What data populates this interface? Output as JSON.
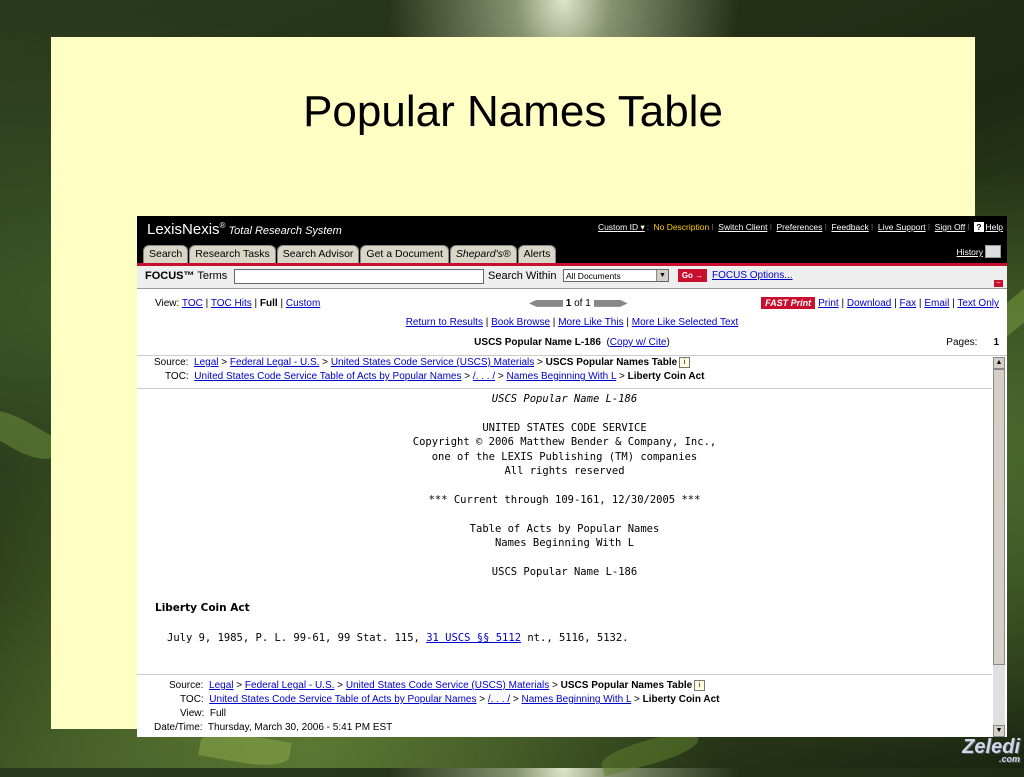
{
  "slide": {
    "title": "Popular Names Table"
  },
  "header": {
    "logo_main": "LexisNexis",
    "logo_reg": "®",
    "logo_sub": "Total Research System",
    "custom_id": "Custom ID ▾",
    "no_description": "No Description",
    "links": [
      "Switch Client",
      "Preferences",
      "Feedback",
      "Live Support",
      "Sign Off"
    ],
    "help_icon": "?",
    "help": "Help",
    "history": "History"
  },
  "tabs": [
    "Search",
    "Research Tasks",
    "Search Advisor",
    "Get a Document",
    "Shepard's®",
    "Alerts"
  ],
  "focus": {
    "label_bold": "FOCUS™",
    "label_terms": "Terms",
    "search_within": "Search Within",
    "scope": "All Documents",
    "go": "Go →",
    "options": "FOCUS Options...",
    "collapse": "–"
  },
  "view": {
    "label": "View:",
    "options": [
      "TOC",
      "TOC Hits",
      "Full",
      "Custom"
    ],
    "selected": "Full"
  },
  "pager": {
    "current": "1",
    "of_total": "of 1"
  },
  "delivery": {
    "fast_print": "FAST Print",
    "links": [
      "Print",
      "Download",
      "Fax",
      "Email",
      "Text Only"
    ]
  },
  "result_links": [
    "Return to Results",
    "Book Browse",
    "More Like This",
    "More Like Selected Text"
  ],
  "doc_title": {
    "title": "USCS Popular Name L-186",
    "copy_cite": "Copy w/ Cite",
    "pages_label": "Pages:",
    "pages_value": "1"
  },
  "source": {
    "label": "Source:",
    "path": [
      "Legal",
      "Federal Legal - U.S.",
      "United States Code Service (USCS) Materials"
    ],
    "current": "USCS Popular Names Table"
  },
  "toc": {
    "label": "TOC:",
    "path": [
      "United States Code Service Table of Acts by Popular Names",
      "/. . . /",
      "Names Beginning With L"
    ],
    "current": "Liberty Coin Act"
  },
  "document": {
    "heading": "USCS Popular Name L-186",
    "lines1": [
      "UNITED STATES CODE SERVICE",
      "Copyright © 2006 Matthew Bender & Company, Inc.,",
      "one of the LEXIS Publishing (TM) companies",
      "All rights reserved"
    ],
    "currency": "*** Current through 109-161, 12/30/2005 ***",
    "lines2": [
      "Table of Acts by Popular Names",
      "Names Beginning With L"
    ],
    "name_repeat": "USCS Popular Name L-186",
    "act_name": "Liberty Coin Act",
    "cite_pre": "July 9, 1985, P. L. 99-61, 99 Stat. 115,",
    "cite_link": "31 USCS §§ 5112",
    "cite_post": "nt., 5116, 5132."
  },
  "footer": {
    "view_label": "View:",
    "view_value": "Full",
    "datetime_label": "Date/Time:",
    "datetime_value": "Thursday, March 30, 2006 - 5:41 PM EST"
  },
  "brand": {
    "name": "Zeledi",
    "sub": ".com"
  }
}
